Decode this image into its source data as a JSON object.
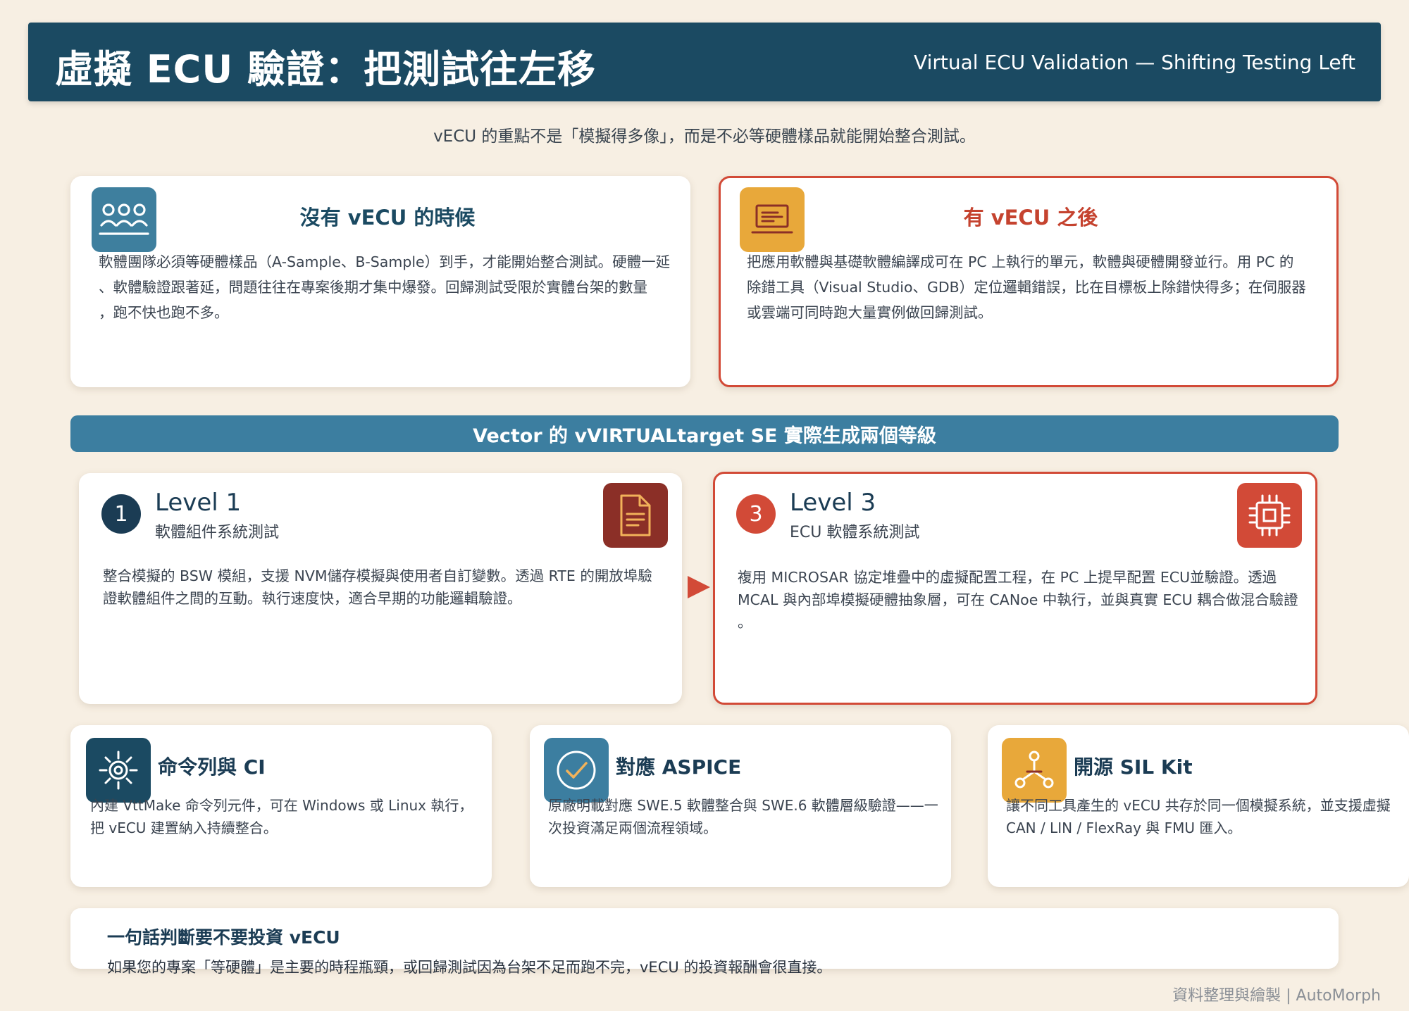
{
  "header": {
    "title": "虛擬 ECU 驗證：把測試往左移",
    "subtitle": "Virtual ECU Validation — Shifting Testing Left"
  },
  "tagline": "vECU 的重點不是「模擬得多像」，而是不必等硬體樣品就能開始整合測試。",
  "comparison": {
    "before": {
      "title": "沒有 vECU 的時候",
      "icon": "team-icon",
      "lines": [
        "軟體團隊必須等硬體樣品（A-Sample、B-Sample）到手，才能開始整合測試。硬體一延",
        "、軟體驗證跟著延，問題往往在專案後期才集中爆發。回歸測試受限於實體台架的數量",
        "，跑不快也跑不多。"
      ]
    },
    "after": {
      "title": "有 vECU 之後",
      "icon": "laptop-icon",
      "lines": [
        "把應用軟體與基礎軟體編譯成可在 PC 上執行的單元，軟體與硬體開發並行。用 PC 的",
        "除錯工具（Visual Studio、GDB）定位邏輯錯誤，比在目標板上除錯快得多；在伺服器",
        "或雲端可同時跑大量實例做回歸測試。"
      ]
    }
  },
  "banner": "Vector 的 vVIRTUALtarget SE 實際生成兩個等級",
  "levels": [
    {
      "number": "1",
      "title": "Level 1",
      "subtitle": "軟體組件系統測試",
      "icon": "document-icon",
      "lines": [
        "整合模擬的 BSW 模組，支援 NVM儲存模擬與使用者自訂變數。透過 RTE 的開放埠驗",
        "證軟體組件之間的互動。執行速度快，適合早期的功能邏輯驗證。"
      ]
    },
    {
      "number": "3",
      "title": "Level 3",
      "subtitle": "ECU 軟體系統測試",
      "icon": "chip-icon",
      "lines": [
        "複用 MICROSAR 協定堆疊中的虛擬配置工程，在 PC 上提早配置 ECU並驗證。透過",
        "MCAL 與內部埠模擬硬體抽象層，可在 CANoe 中執行，並與真實 ECU 耦合做混合驗證",
        "。"
      ]
    }
  ],
  "features": [
    {
      "title": "命令列與 CI",
      "icon": "gear-icon",
      "lines": [
        "內建 VttMake 命令列元件，可在 Windows 或 Linux 執行，",
        "把 vECU 建置納入持續整合。"
      ]
    },
    {
      "title": "對應 ASPICE",
      "icon": "check-circle-icon",
      "lines": [
        "原廠明載對應 SWE.5 軟體整合與 SWE.6 軟體層級驗證——一",
        "次投資滿足兩個流程領域。"
      ]
    },
    {
      "title": "開源 SIL Kit",
      "icon": "network-icon",
      "lines": [
        "讓不同工具產生的 vECU 共存於同一個模擬系統，並支援虛擬",
        "CAN / LIN / FlexRay 與 FMU 匯入。"
      ]
    }
  ],
  "summary": {
    "title": "一句話判斷要不要投資 vECU",
    "body": "如果您的專案「等硬體」是主要的時程瓶頸，或回歸測試因為台架不足而跑不完，vECU 的投資報酬會很直接。"
  },
  "credit": "資料整理與繪製 | AutoMorph",
  "colors": {
    "navy": "#1b4a62",
    "teal": "#3c7ea0",
    "red": "#d24a37",
    "orange": "#e8a83a",
    "maroon": "#8b2f27",
    "background": "#f7efe3"
  }
}
